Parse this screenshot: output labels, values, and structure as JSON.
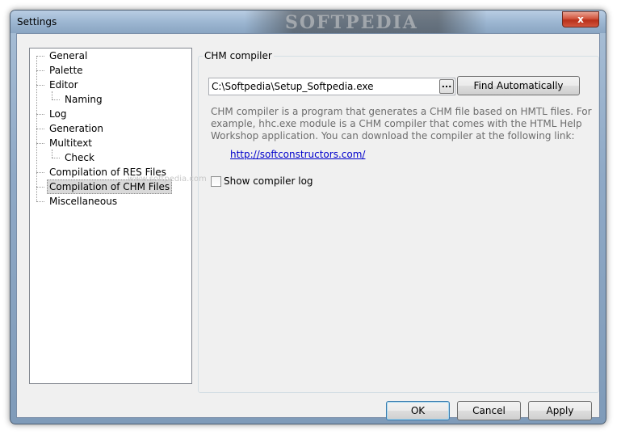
{
  "window": {
    "title": "Settings",
    "watermark": "SOFTPEDIA",
    "close_glyph": "x"
  },
  "tree": {
    "items": [
      {
        "label": "General"
      },
      {
        "label": "Palette"
      },
      {
        "label": "Editor"
      },
      {
        "label": "Naming"
      },
      {
        "label": "Log"
      },
      {
        "label": "Generation"
      },
      {
        "label": "Multitext"
      },
      {
        "label": "Check"
      },
      {
        "label": "Compilation of RES Files"
      },
      {
        "label": "Compilation of CHM Files",
        "selected": true
      },
      {
        "label": "Miscellaneous"
      }
    ],
    "watermark": "www.softpedia.com"
  },
  "chm": {
    "group_title": "CHM compiler",
    "path_value": "C:\\Softpedia\\Setup_Softpedia.exe",
    "browse_label": "...",
    "find_label": "Find Automatically",
    "description": "CHM compiler is a program that generates a CHM file based on HMTL files. For example, hhc.exe module is a CHM compiler that comes with the HTML Help Workshop application. You can download the compiler at the following link:",
    "link": "http://softconstructors.com/",
    "show_log_label": "Show compiler log",
    "show_log_checked": false
  },
  "buttons": {
    "ok": "OK",
    "cancel": "Cancel",
    "apply": "Apply"
  },
  "colors": {
    "titlebar": "#9db7d2",
    "client": "#f0f0f0",
    "link": "#0000cc",
    "description": "#6d6d6d"
  }
}
